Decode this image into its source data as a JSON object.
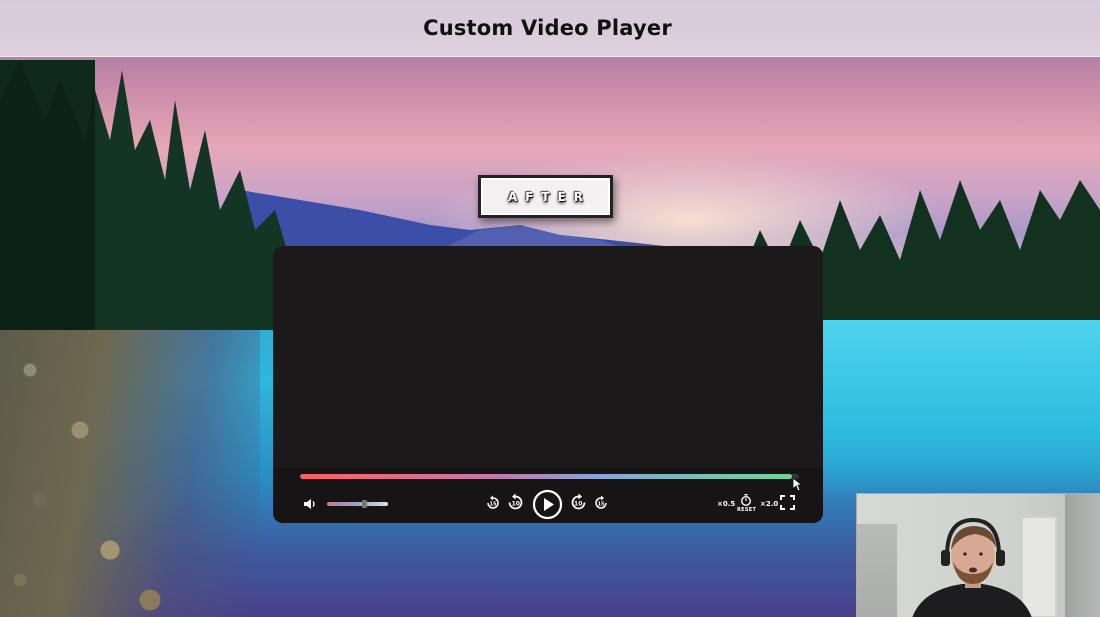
{
  "header": {
    "title": "Custom Video Player"
  },
  "badge": {
    "label": "AFTER"
  },
  "player": {
    "progress_fraction": 0.985,
    "volume_fraction": 0.6,
    "controls": {
      "volume_icon": "volume-icon",
      "rewind_15": "15",
      "rewind_10": "10",
      "forward_10": "10",
      "forward_15": "15",
      "slower_label": "×0.5",
      "reset_label": "RESET",
      "faster_label": "×2.0",
      "fullscreen_icon": "fullscreen-icon",
      "play_icon": "play-icon"
    }
  },
  "colors": {
    "progress_start": "#ff5f5f",
    "progress_end": "#6fd59a",
    "player_bg": "#1a1819"
  }
}
